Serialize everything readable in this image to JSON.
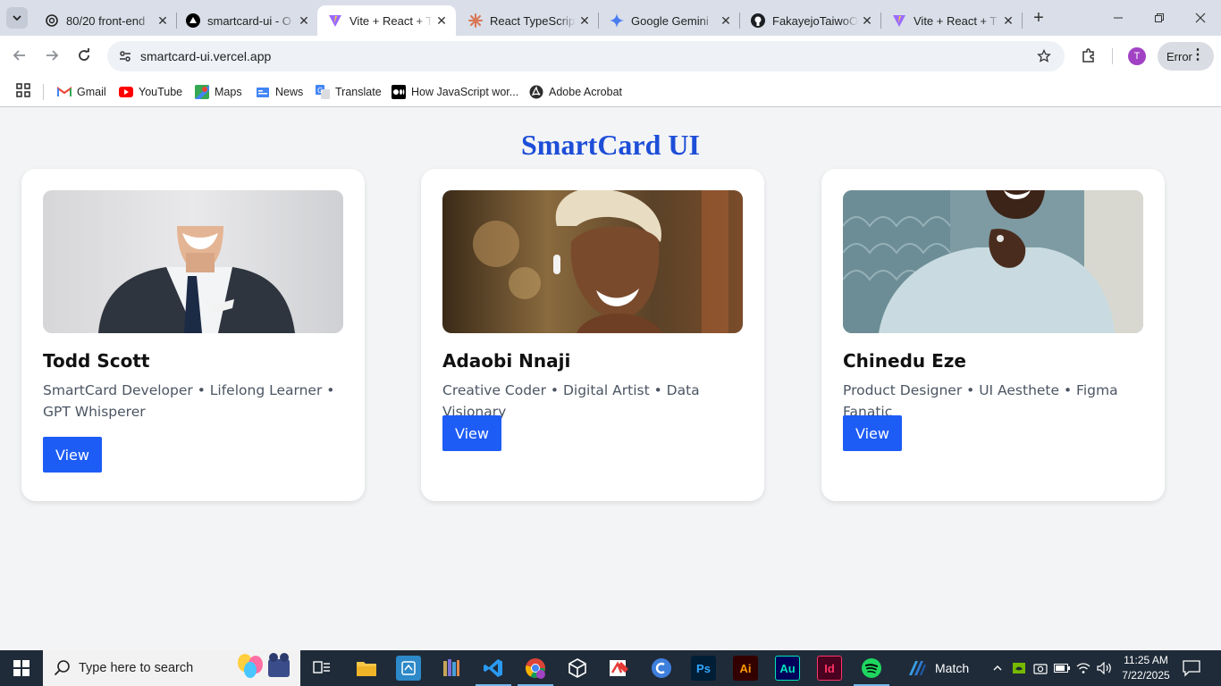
{
  "browser": {
    "tabs": [
      {
        "title": "80/20 front-end",
        "icon": "chatgpt-icon",
        "active": false
      },
      {
        "title": "smartcard-ui - O",
        "icon": "vercel-icon",
        "active": false
      },
      {
        "title": "Vite + React + T",
        "icon": "vite-icon",
        "active": true
      },
      {
        "title": "React TypeScript",
        "icon": "claude-icon",
        "active": false
      },
      {
        "title": "Google Gemini",
        "icon": "gemini-icon",
        "active": false
      },
      {
        "title": "FakayejoTaiwoO",
        "icon": "github-icon",
        "active": false
      },
      {
        "title": "Vite + React + T",
        "icon": "vite-icon",
        "active": false
      }
    ],
    "url": "smartcard-ui.vercel.app",
    "profile_initial": "T",
    "error_label": "Error",
    "bookmarks": [
      {
        "label": "Gmail",
        "icon": "gmail-icon"
      },
      {
        "label": "YouTube",
        "icon": "youtube-icon"
      },
      {
        "label": "Maps",
        "icon": "maps-icon"
      },
      {
        "label": "News",
        "icon": "news-icon"
      },
      {
        "label": "Translate",
        "icon": "translate-icon"
      },
      {
        "label": "How JavaScript wor...",
        "icon": "medium-icon"
      },
      {
        "label": "Adobe Acrobat",
        "icon": "acrobat-icon"
      }
    ]
  },
  "page": {
    "title": "SmartCard UI",
    "cards": [
      {
        "name": "Todd Scott",
        "description": "SmartCard Developer • Lifelong Learner • GPT Whisperer",
        "button": "View",
        "photo": "man-in-suit-photo"
      },
      {
        "name": "Adaobi Nnaji",
        "description": "Creative Coder • Digital Artist • Data Visionary",
        "button": "View",
        "photo": "smiling-woman-photo"
      },
      {
        "name": "Chinedu Eze",
        "description": "Product Designer • UI Aesthete • Figma Fanatic",
        "button": "View",
        "photo": "woman-in-sweater-photo"
      }
    ]
  },
  "taskbar": {
    "search_placeholder": "Type here to search",
    "spotify_label": "Match",
    "time": "11:25 AM",
    "date": "7/22/2025",
    "pinned": [
      "task-view-icon",
      "file-explorer-icon",
      "app-icon",
      "library-icon",
      "vscode-icon",
      "chrome-icon",
      "unity-icon",
      "pdf-editor-icon",
      "canva-icon",
      "photoshop-icon",
      "illustrator-icon",
      "audition-icon",
      "indesign-icon",
      "spotify-icon"
    ]
  },
  "colors": {
    "accent": "#1d4ed8",
    "button": "#1d5cf5",
    "page_bg": "#f3f4f6"
  }
}
